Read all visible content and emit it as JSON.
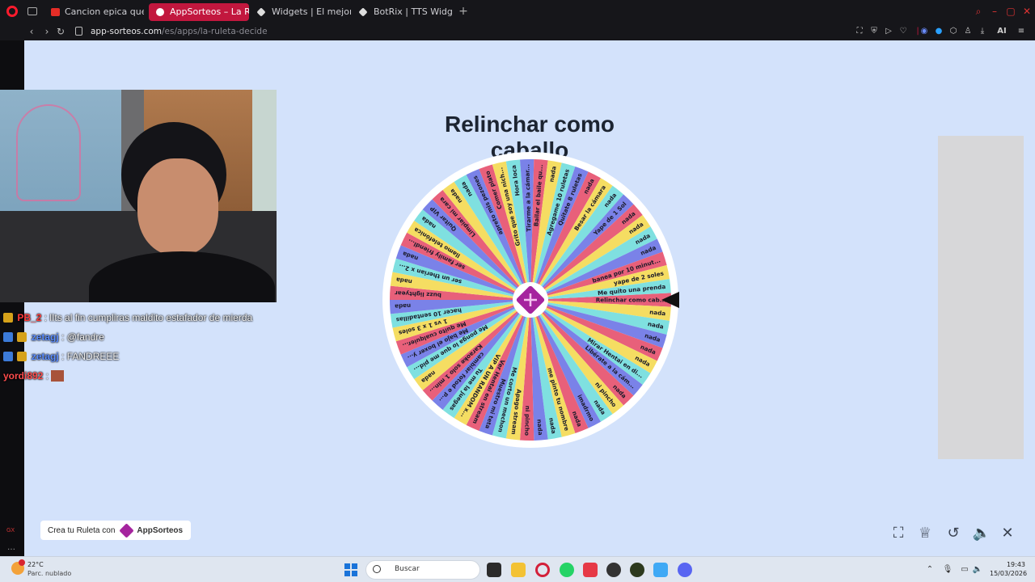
{
  "browser": {
    "tabs": [
      {
        "label": "Cancion epica que us",
        "icon_color": "#e52d27"
      },
      {
        "label": "AppSorteos – La Ruleta de",
        "icon_color": "#ffffff"
      },
      {
        "label": "Widgets | El mejor softwa",
        "icon_color": "#dddddd"
      },
      {
        "label": "BotRix | TTS Widget",
        "icon_color": "#dddddd"
      }
    ],
    "url_domain": "app-sorteos.com",
    "url_path": "/es/apps/la-ruleta-decide",
    "accent": "#c2173e",
    "ai_label": "AI"
  },
  "page": {
    "title": "Relinchar como caballo",
    "promo_text": "Crea tu Ruleta con",
    "promo_brand": "AppSorteos"
  },
  "wheel": {
    "colors": [
      "#e8607a",
      "#f5dd62",
      "#7fe0e0",
      "#7a82e8"
    ],
    "selected": "Relinchar como cab...",
    "segments": [
      "Relinchar como cab...",
      "nada",
      "nada",
      "nada",
      "nada",
      "nada",
      "Mirar Hentai en di...",
      "Libérate a la cám...",
      "nada",
      "ni pincho",
      "nada",
      "imadrmo",
      "nada",
      "me pinto tu nombre",
      "nada",
      "nada",
      "ni pincho",
      "Apago stream",
      "Me corto un mechon",
      "Muestro mi teta",
      "Ver Hentai en stream",
      "VIP A UN RANDOM x...",
      "Tu me la juegas",
      "cambiar fotod e p...",
      "Karaoke solo 1 min...",
      "nada",
      "Me ponga lo que me pid...",
      "Me bajo el boxer y...",
      "Me quito cualquier...",
      "1 vs 1 x 3 soles",
      "hacer 10 sentadillas",
      "nada",
      "buzz lightyear",
      "nada",
      "ser un therian x 2...",
      "nada",
      "ser family friendl...",
      "llamo telefónica",
      "nada",
      "Quitar VIP",
      "Limpiar mi cara",
      "nada",
      "nada",
      "apreto mis pezones",
      "Comer plato",
      "Grito que soy una nich...",
      "Hora loca",
      "Tirarme a la cámar...",
      "Bailar el baile qu...",
      "nada",
      "Agregame 10 ruletas",
      "Quitate 8 ruletas",
      "nada",
      "Besar la cámara",
      "nada",
      "Yape de 1 Sol",
      "nada",
      "nada",
      "nada",
      "nada",
      "banea por 10 minut...",
      "yape de 2 soles",
      "Me quito una prenda"
    ]
  },
  "controls": [
    "fullscreen-icon",
    "trophy-icon",
    "reset-icon",
    "volume-icon",
    "close-icon"
  ],
  "chat": [
    {
      "user": "PB_2",
      "user_color": "#ff3b3b",
      "message": ": lIts al fin cumpliras maldito estafador de mierda"
    },
    {
      "user": "zetagj",
      "user_color": "#5a8cff",
      "message": ": @fandre"
    },
    {
      "user": "zetagj",
      "user_color": "#5a8cff",
      "message": ": FANDREEE"
    },
    {
      "user": "yordi892",
      "user_color": "#ff4d4d",
      "message": ":"
    }
  ],
  "taskbar": {
    "temp": "22°C",
    "weather": "Parc. nublado",
    "search_placeholder": "Buscar",
    "time": "19:43",
    "date": "15/03/2026"
  }
}
